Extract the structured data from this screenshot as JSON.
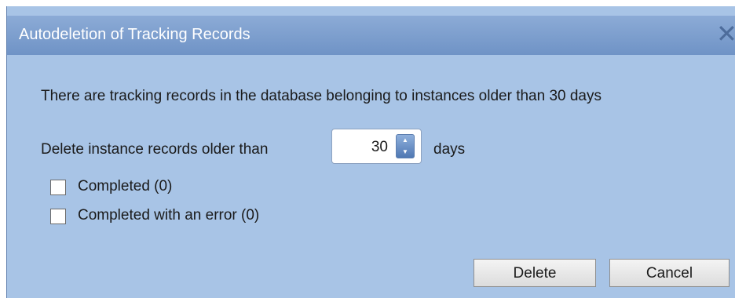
{
  "dialog": {
    "title": "Autodeletion of Tracking Records",
    "close_icon": "close-icon",
    "message": "There are tracking records in the database belonging to instances older than 30 days",
    "older_than_label": "Delete instance records older than",
    "days_value": "30",
    "days_unit_label": "days",
    "spinner_up_icon": "▲",
    "spinner_down_icon": "▼",
    "options": [
      {
        "label": "Completed (0)",
        "checked": false
      },
      {
        "label": "Completed with an error (0)",
        "checked": false
      }
    ],
    "delete_label": "Delete",
    "cancel_label": "Cancel"
  },
  "colors": {
    "dialog_background": "#a8c4e6",
    "titlebar": "#7a9cce",
    "title_text": "#ffffff"
  }
}
